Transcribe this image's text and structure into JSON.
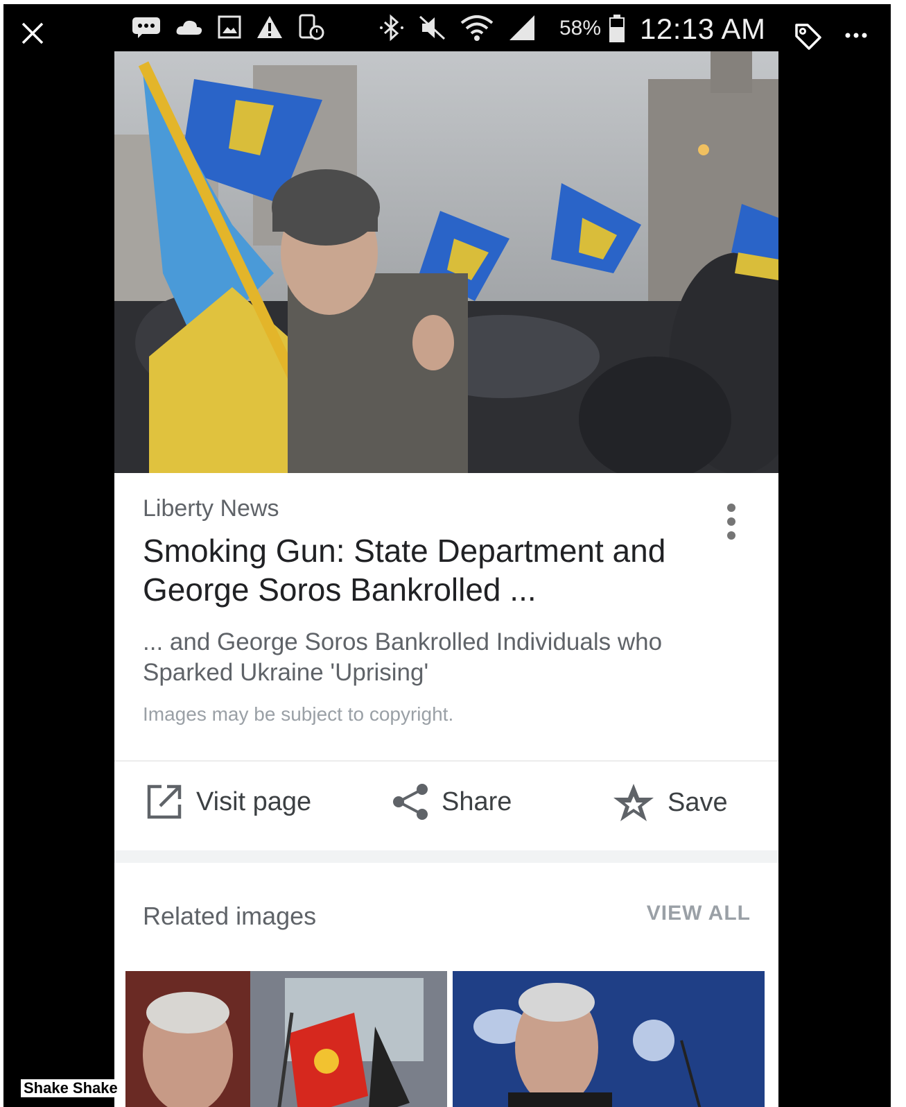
{
  "status_bar": {
    "battery_percent": "58%",
    "time": "12:13 AM"
  },
  "result": {
    "source": "Liberty News",
    "title": "Smoking Gun: State Department and George Soros Bankrolled ...",
    "snippet": "... and George Soros Bankrolled Individuals who Sparked Ukraine 'Uprising'",
    "copyright_notice": "Images may be subject to copyright."
  },
  "actions": {
    "visit_label": "Visit page",
    "share_label": "Share",
    "save_label": "Save"
  },
  "related": {
    "title": "Related images",
    "view_all_label": "VIEW ALL"
  },
  "overlay_caption": "Shake Shake",
  "colors": {
    "background": "#000000",
    "card": "#ffffff",
    "text_primary": "#202124",
    "text_secondary": "#5f6368",
    "flag_blue": "#2a64c8",
    "flag_yellow": "#e8c63a"
  }
}
